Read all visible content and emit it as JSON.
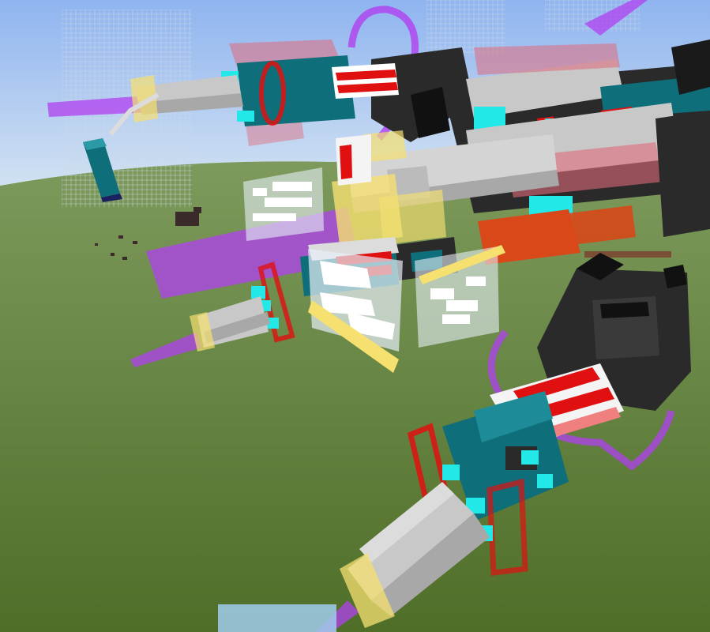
{
  "scene": {
    "colors": {
      "sky_top": "#8fb4f0",
      "sky_horizon": "#d8e6f2",
      "grass_far": "#7d9a5c",
      "grass_near": "#4f6e28",
      "glass": "#e6eef7",
      "teal": "#0e6e7a",
      "cyan": "#22e8e8",
      "red": "#e01010",
      "pink_glass": "#e06a7a",
      "purple": "#b040f0",
      "yellow_glass": "#f5e070",
      "light_gray": "#c8c8c8",
      "dark_gray": "#2a2a2a",
      "white": "#f4f4f4",
      "orange": "#d84818"
    },
    "icons": [
      "sky-background",
      "grass-terrain",
      "glass-tower",
      "mech-turret-upper",
      "mech-turret-middle",
      "mech-turret-lower",
      "beam-laser",
      "glass-sign"
    ]
  }
}
